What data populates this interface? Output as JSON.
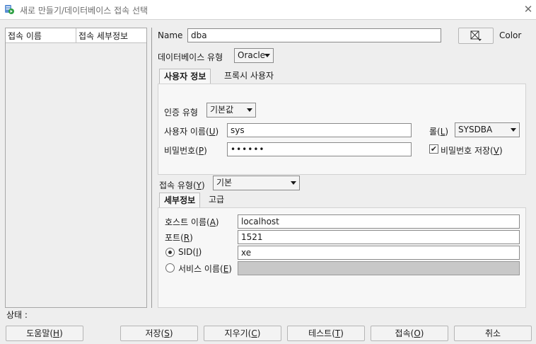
{
  "window": {
    "title": "새로 만들기/데이터베이스 접속 선택",
    "close_glyph": "✕"
  },
  "connections_table": {
    "columns": [
      "접속 이름",
      "접속 세부정보"
    ]
  },
  "form": {
    "name_label": "Name",
    "name_value": "dba",
    "color_label": "Color",
    "db_type_label": "데이터베이스 유형",
    "db_type_value": "Oracle",
    "auth_tabs": [
      "사용자 정보",
      "프록시 사용자"
    ],
    "auth_type_label": "인증 유형",
    "auth_type_value": "기본값",
    "username_label": "사용자 이름(U)",
    "username_value": "sys",
    "role_label": "롤(L)",
    "role_value": "SYSDBA",
    "password_label": "비밀번호(P)",
    "password_value": "••••••",
    "save_password_label": "비밀번호 저장(V)",
    "save_password_checked": true,
    "conn_type_label": "접속 유형(Y)",
    "conn_type_value": "기본",
    "detail_tabs": [
      "세부정보",
      "고급"
    ],
    "host_label": "호스트 이름(A)",
    "host_value": "localhost",
    "port_label": "포트(R)",
    "port_value": "1521",
    "sid_label": "SID(I)",
    "sid_value": "xe",
    "sid_selected": true,
    "service_label": "서비스 이름(E)",
    "service_value": ""
  },
  "status": {
    "label": "상태 :"
  },
  "buttons": {
    "help": "도움말(H)",
    "save": "저장(S)",
    "clear": "지우기(C)",
    "test": "테스트(T)",
    "connect": "접속(O)",
    "cancel": "취소"
  }
}
